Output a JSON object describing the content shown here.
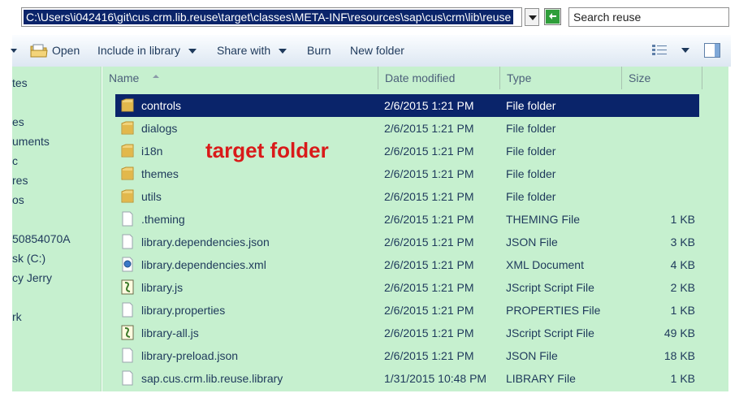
{
  "address_bar": {
    "path": "C:\\Users\\i042416\\git\\cus.crm.lib.reuse\\target\\classes\\META-INF\\resources\\sap\\cus\\crm\\lib\\reuse",
    "search_placeholder": "Search reuse"
  },
  "toolbar": {
    "open_label": "Open",
    "include_label": "Include in library",
    "share_label": "Share with",
    "burn_label": "Burn",
    "new_folder_label": "New folder"
  },
  "navigation": {
    "items": [
      "tes",
      "es",
      "uments",
      "c",
      "res",
      "os",
      "50854070A",
      "sk (C:)",
      "cy Jerry",
      "rk"
    ]
  },
  "columns": {
    "name": "Name",
    "date": "Date modified",
    "type": "Type",
    "size": "Size"
  },
  "files": [
    {
      "name": "controls",
      "date": "2/6/2015 1:21 PM",
      "type": "File folder",
      "size": "",
      "icon": "folder-icon"
    },
    {
      "name": "dialogs",
      "date": "2/6/2015 1:21 PM",
      "type": "File folder",
      "size": "",
      "icon": "folder-icon"
    },
    {
      "name": "i18n",
      "date": "2/6/2015 1:21 PM",
      "type": "File folder",
      "size": "",
      "icon": "folder-icon"
    },
    {
      "name": "themes",
      "date": "2/6/2015 1:21 PM",
      "type": "File folder",
      "size": "",
      "icon": "folder-icon"
    },
    {
      "name": "utils",
      "date": "2/6/2015 1:21 PM",
      "type": "File folder",
      "size": "",
      "icon": "folder-icon"
    },
    {
      "name": ".theming",
      "date": "2/6/2015 1:21 PM",
      "type": "THEMING File",
      "size": "1 KB",
      "icon": "document-icon"
    },
    {
      "name": "library.dependencies.json",
      "date": "2/6/2015 1:21 PM",
      "type": "JSON File",
      "size": "3 KB",
      "icon": "document-icon"
    },
    {
      "name": "library.dependencies.xml",
      "date": "2/6/2015 1:21 PM",
      "type": "XML Document",
      "size": "4 KB",
      "icon": "xml-document-icon"
    },
    {
      "name": "library.js",
      "date": "2/6/2015 1:21 PM",
      "type": "JScript Script File",
      "size": "2 KB",
      "icon": "script-icon"
    },
    {
      "name": "library.properties",
      "date": "2/6/2015 1:21 PM",
      "type": "PROPERTIES File",
      "size": "1 KB",
      "icon": "document-icon"
    },
    {
      "name": "library-all.js",
      "date": "2/6/2015 1:21 PM",
      "type": "JScript Script File",
      "size": "49 KB",
      "icon": "script-icon"
    },
    {
      "name": "library-preload.json",
      "date": "2/6/2015 1:21 PM",
      "type": "JSON File",
      "size": "18 KB",
      "icon": "document-icon"
    },
    {
      "name": "sap.cus.crm.lib.reuse.library",
      "date": "1/31/2015 10:48 PM",
      "type": "LIBRARY File",
      "size": "1 KB",
      "icon": "document-icon"
    }
  ],
  "annotation": "target folder",
  "colors": {
    "pane_background": "#c6f0cf",
    "selection": "#0a246a",
    "annotation": "#d91a1a",
    "link_text": "#1e395b"
  }
}
